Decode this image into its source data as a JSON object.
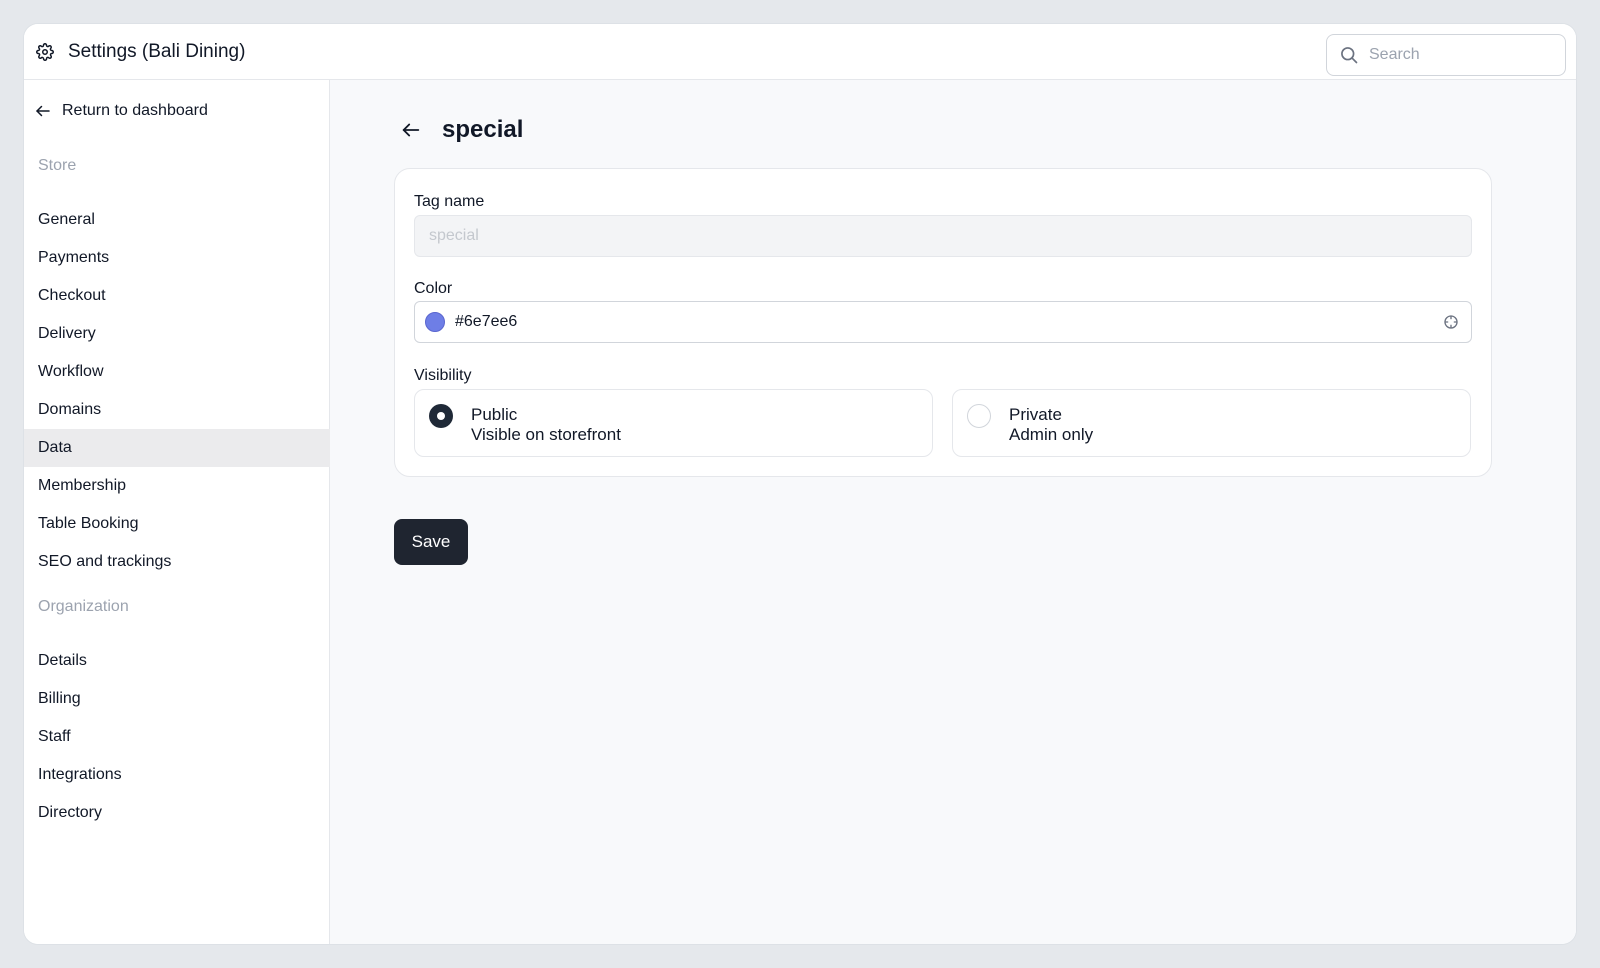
{
  "header": {
    "title": "Settings (Bali Dining)",
    "search_placeholder": "Search"
  },
  "sidebar": {
    "return_label": "Return to dashboard",
    "store_label": "Store",
    "store_items": [
      {
        "label": "General"
      },
      {
        "label": "Payments"
      },
      {
        "label": "Checkout"
      },
      {
        "label": "Delivery"
      },
      {
        "label": "Workflow"
      },
      {
        "label": "Domains"
      },
      {
        "label": "Data",
        "active": true
      },
      {
        "label": "Membership"
      },
      {
        "label": "Table Booking"
      },
      {
        "label": "SEO and trackings"
      }
    ],
    "organization_label": "Organization",
    "organization_items": [
      {
        "label": "Details"
      },
      {
        "label": "Billing"
      },
      {
        "label": "Staff"
      },
      {
        "label": "Integrations"
      },
      {
        "label": "Directory"
      }
    ]
  },
  "main": {
    "page_title": "special",
    "tag_name_label": "Tag name",
    "tag_name_placeholder": "special",
    "color_label": "Color",
    "color_value": "#6e7ee6",
    "visibility_label": "Visibility",
    "visibility_options": [
      {
        "title": "Public",
        "description": "Visible on storefront",
        "selected": true
      },
      {
        "title": "Private",
        "description": "Admin only",
        "selected": false
      }
    ],
    "save_label": "Save"
  },
  "colors": {
    "swatch": "#6e7ee6",
    "primary_button": "#1f2530",
    "active_nav": "#ebebed"
  }
}
